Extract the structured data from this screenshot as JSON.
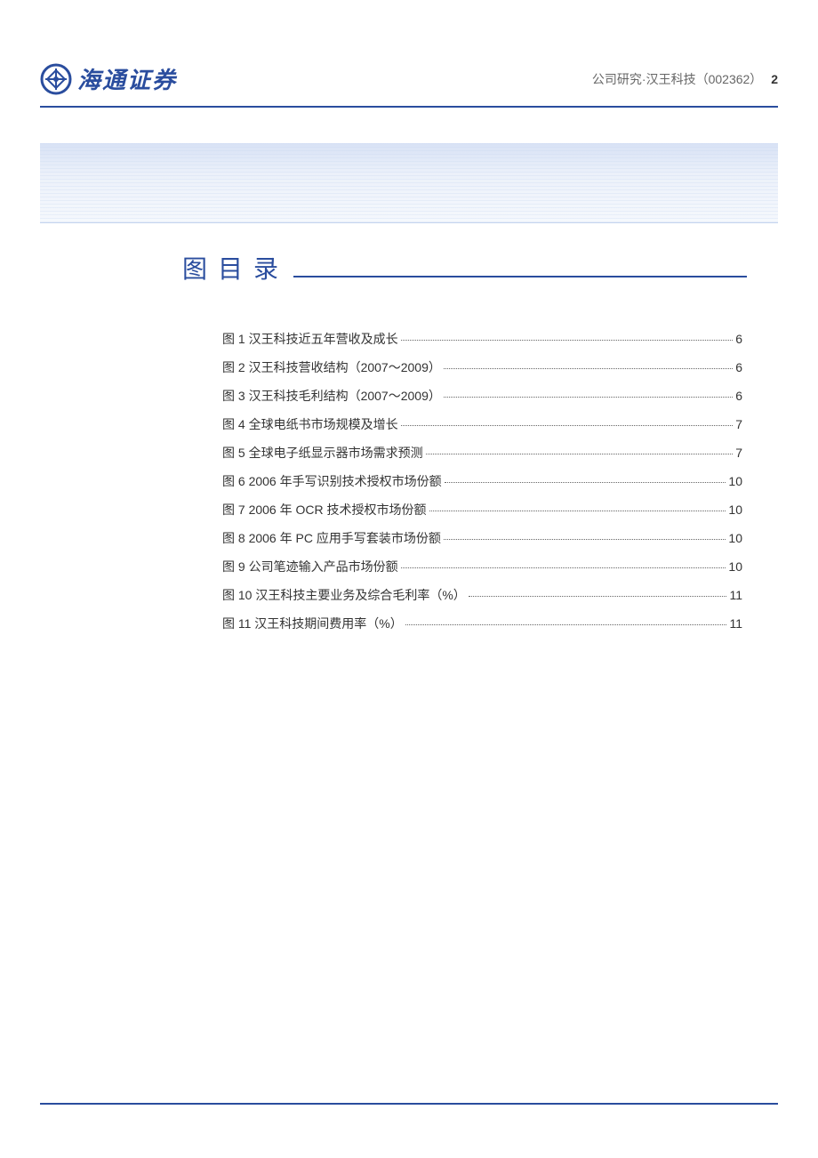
{
  "header": {
    "logo_text": "海通证券",
    "breadcrumb": "公司研究·汉王科技（002362）",
    "page_number": "2"
  },
  "section": {
    "title": "图目录"
  },
  "toc": {
    "items": [
      {
        "label": "图 1 汉王科技近五年营收及成长",
        "page": "6"
      },
      {
        "label": "图 2 汉王科技营收结构（2007～2009）",
        "page": "6"
      },
      {
        "label": "图 3 汉王科技毛利结构（2007～2009）",
        "page": "6"
      },
      {
        "label": "图 4 全球电纸书市场规模及增长",
        "page": "7"
      },
      {
        "label": "图 5 全球电子纸显示器市场需求预测",
        "page": "7"
      },
      {
        "label": "图 6 2006 年手写识别技术授权市场份额",
        "page": "10"
      },
      {
        "label": "图 7 2006 年 OCR 技术授权市场份额",
        "page": "10"
      },
      {
        "label": "图 8 2006 年 PC 应用手写套装市场份额",
        "page": "10"
      },
      {
        "label": "图 9 公司笔迹输入产品市场份额",
        "page": "10"
      },
      {
        "label": "图 10 汉王科技主要业务及综合毛利率（%）",
        "page": "11"
      },
      {
        "label": "图 11 汉王科技期间费用率（%）",
        "page": "11"
      }
    ]
  },
  "colors": {
    "accent": "#2a4d9e"
  }
}
